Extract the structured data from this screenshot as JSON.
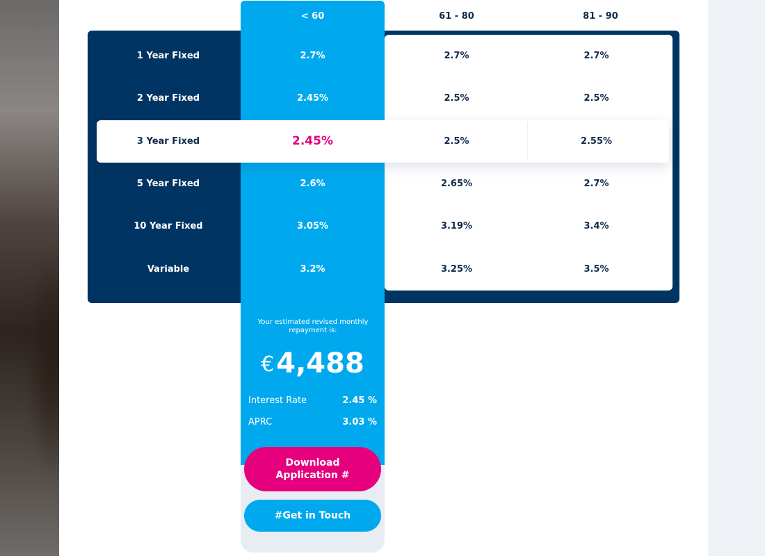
{
  "table": {
    "headers": [
      "< 60",
      "61 - 80",
      "81 - 90"
    ],
    "rows": [
      {
        "label": "1 Year Fixed",
        "values": [
          "2.7%",
          "2.7%",
          "2.7%"
        ]
      },
      {
        "label": "2 Year Fixed",
        "values": [
          "2.45%",
          "2.5%",
          "2.5%"
        ]
      },
      {
        "label": "3 Year Fixed",
        "values": [
          "2.45%",
          "2.5%",
          "2.55%"
        ]
      },
      {
        "label": "5 Year Fixed",
        "values": [
          "2.6%",
          "2.65%",
          "2.7%"
        ]
      },
      {
        "label": "10 Year Fixed",
        "values": [
          "3.05%",
          "3.19%",
          "3.4%"
        ]
      },
      {
        "label": "Variable",
        "values": [
          "3.2%",
          "3.25%",
          "3.5%"
        ]
      }
    ],
    "selected_row": "3 Year Fixed",
    "selected_column": "< 60"
  },
  "summary": {
    "estimate_text": "Your estimated revised monthly repayment is:",
    "currency": "€",
    "amount": "4,488",
    "interest_rate_label": "Interest Rate",
    "interest_rate_value": "2.45 %",
    "aprc_label": "APRC",
    "aprc_value": "3.03 %"
  },
  "buttons": {
    "download_line1": "Download",
    "download_line2": "Application #",
    "get_in_touch": "#Get in Touch"
  },
  "colors": {
    "navy": "#003463",
    "blue": "#00a9ee",
    "pink": "#e6007e",
    "grey": "#e8edf3"
  }
}
